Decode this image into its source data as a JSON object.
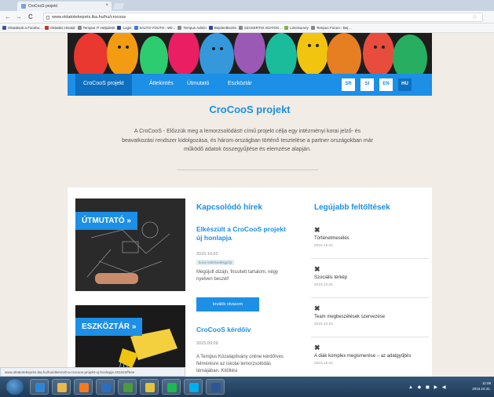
{
  "browser": {
    "tab_title": "CroCooS projekt",
    "tab_close": "×",
    "back": "←",
    "forward": "→",
    "reload": "C",
    "url": "www.oktatotekeprés.tka.hu/hu/crocoos",
    "star": "☆",
    "bookmarks": [
      {
        "label": "Oktatások a Facebo...",
        "color": "#3b5998"
      },
      {
        "label": "Oktatási Hivatal",
        "color": "#c0392b"
      },
      {
        "label": "Tempus IT Helpdesk",
        "color": "#888888"
      },
      {
        "label": "Login",
        "color": "#2a4b8d"
      },
      {
        "label": "SALTO-YOUTH - Wir...",
        "color": "#3a7bd5"
      },
      {
        "label": "Tempus Admin",
        "color": "#888888"
      },
      {
        "label": "Bejelentkezés",
        "color": "#2a4b8d"
      },
      {
        "label": "SZAKERTOI ADATOK...",
        "color": "#888888"
      },
      {
        "label": "LimeSurvey",
        "color": "#7ab648"
      },
      {
        "label": "Tempus Forum - Bej...",
        "color": "#888888"
      }
    ],
    "status_url": "www.oktatotekeprés.tka.hu/hu/elkeszult-a-crocoos-projekt-uj-honlapja-151023/ftree"
  },
  "nav": {
    "items": [
      "CroCooS projekt",
      "Áttekintés",
      "Útmutató",
      "Eszköztár"
    ],
    "languages": [
      "SR",
      "SI",
      "EN",
      "HU"
    ]
  },
  "main": {
    "title": "CroCooS projekt",
    "intro": "A CroCooS - Előzzük meg a lemorzsolódást! című projekt célja egy intézményi korai jelző- és beavatkozási rendszer kidolgozása, és három országban történő tesztelése a partner országokban már működő adatok összegyűjtése és elemzése alapján."
  },
  "promos": {
    "utmutato": "ÚTMUTATÓ »",
    "eszkoztar": "ESZKÖZTÁR »"
  },
  "news": {
    "heading": "Kapcsolódó hírek",
    "items": [
      {
        "title": "Elkészült a CroCooS projekt új honlapja",
        "date": "2015.10.02",
        "tag": "korai intézkedésgyűjt",
        "text": "Megújult dizájn, frissített tartalom, négy nyelven beszél!",
        "button": "tovább olvasom"
      },
      {
        "title": "CroCooS kérdőív",
        "date": "2015.09.09",
        "text": "A Tempus Közalapítvány online kérdőíves felmérésre az iskolai lemorzsolódás témájában. Kitöltési"
      }
    ]
  },
  "uploads": {
    "heading": "Legújabb feltöltések",
    "items": [
      {
        "icon": "✖",
        "title": "Történetmesélés",
        "date": "2015.10.01"
      },
      {
        "icon": "✖",
        "title": "Szociális térkép",
        "date": "2015.10.01"
      },
      {
        "icon": "✖",
        "title": "Team megbeszélések szervezése",
        "date": "2015.10.01"
      },
      {
        "icon": "✖",
        "title": "A diák komplex megismerése – az adatgyűjtés",
        "date": "2015.10.01"
      }
    ]
  },
  "taskbar": {
    "apps": [
      {
        "name": "ie",
        "color": "#2f86d6"
      },
      {
        "name": "explorer",
        "color": "#e8b84a"
      },
      {
        "name": "media",
        "color": "#f07b22"
      },
      {
        "name": "outlook",
        "color": "#2c6fbf"
      },
      {
        "name": "lync",
        "color": "#4a9b3c"
      },
      {
        "name": "chrome",
        "color": "#e3c33b"
      },
      {
        "name": "spotify",
        "color": "#1db954"
      },
      {
        "name": "skype",
        "color": "#00aff0"
      },
      {
        "name": "word",
        "color": "#2b5797"
      }
    ],
    "time": "11:08",
    "date": "2015.10.31."
  }
}
